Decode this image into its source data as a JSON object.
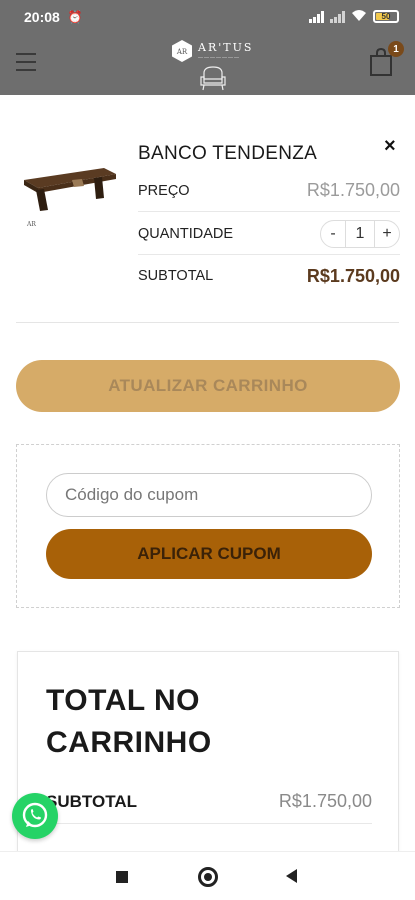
{
  "status_bar": {
    "time": "20:08",
    "battery": "50"
  },
  "header": {
    "logo_text": "AR'TUS",
    "cart_count": "1"
  },
  "cart_item": {
    "name": "BANCO TENDENZA",
    "price_label": "PREÇO",
    "price": "R$1.750,00",
    "quantity_label": "QUANTIDADE",
    "quantity": "1",
    "minus": "-",
    "plus": "+",
    "subtotal_label": "SUBTOTAL",
    "subtotal": "R$1.750,00",
    "remove": "×"
  },
  "actions": {
    "update_cart": "ATUALIZAR CARRINHO"
  },
  "coupon": {
    "placeholder": "Código do cupom",
    "apply": "APLICAR CUPOM"
  },
  "totals": {
    "title": "TOTAL NO CARRINHO",
    "subtotal_label": "SUBTOTAL",
    "subtotal_value": "R$1.750,00"
  },
  "colors": {
    "header_bg": "#6e6e6e",
    "update_button": "#d6ab68",
    "apply_button": "#a86108",
    "subtotal_strong": "#5b3a1e",
    "whatsapp": "#25d366"
  },
  "icons": {
    "menu": "hamburger-icon",
    "cart": "shopping-bag-icon",
    "remove": "close-icon",
    "whatsapp": "whatsapp-icon",
    "nav_recent": "square-icon",
    "nav_home": "circle-icon",
    "nav_back": "triangle-back-icon"
  }
}
